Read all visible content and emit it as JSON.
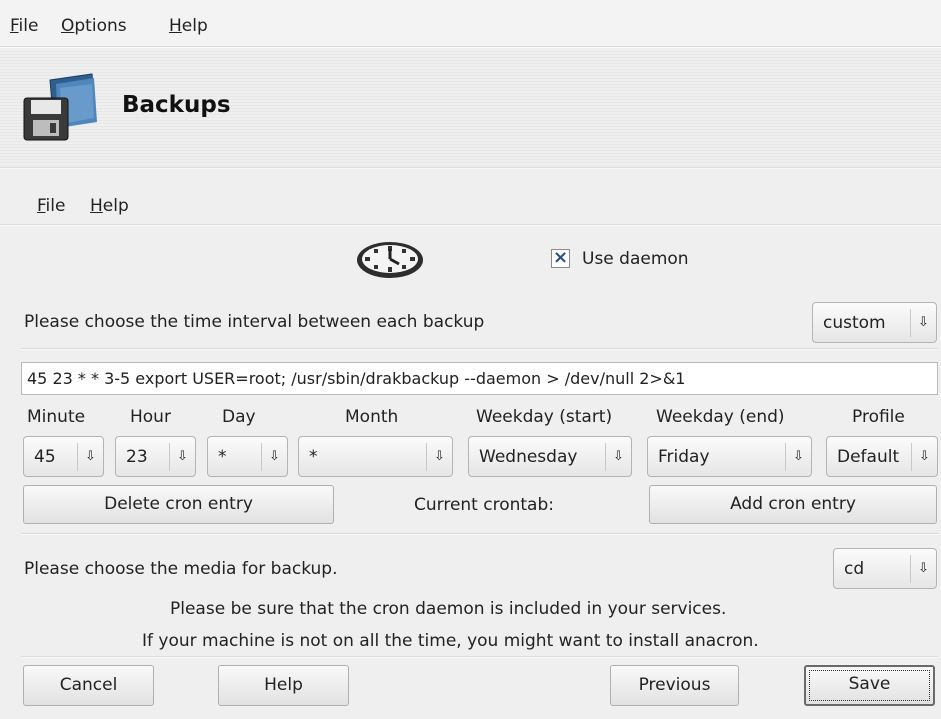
{
  "menubar": {
    "items": [
      {
        "label": "File",
        "mnemonic": "F",
        "rest": "ile"
      },
      {
        "label": "Options",
        "mnemonic": "O",
        "rest": "ptions"
      },
      {
        "label": "Help",
        "mnemonic": "H",
        "rest": "elp"
      }
    ]
  },
  "header": {
    "title": "Backups",
    "icon": "floppy-folder-icon"
  },
  "submenu": {
    "items": [
      {
        "label": "File",
        "mnemonic": "F",
        "rest": "ile"
      },
      {
        "label": "Help",
        "mnemonic": "H",
        "rest": "elp"
      }
    ]
  },
  "daemon": {
    "icon": "clock-icon",
    "checkbox_label": "Use daemon",
    "checked": true,
    "check_mark": "×"
  },
  "interval": {
    "prompt": "Please choose the time interval between each backup",
    "value": "custom"
  },
  "cron_line": "45 23 * * 3-5 export USER=root; /usr/sbin/drakbackup  --daemon > /dev/null 2>&1",
  "fields": {
    "minute": {
      "label": "Minute",
      "value": "45"
    },
    "hour": {
      "label": "Hour",
      "value": "23"
    },
    "day": {
      "label": "Day",
      "value": "*"
    },
    "month": {
      "label": "Month",
      "value": "*"
    },
    "weekday_start": {
      "label": "Weekday (start)",
      "value": "Wednesday"
    },
    "weekday_end": {
      "label": "Weekday (end)",
      "value": "Friday"
    },
    "profile": {
      "label": "Profile",
      "value": "Default"
    }
  },
  "cron_buttons": {
    "delete": "Delete cron entry",
    "current": "Current crontab:",
    "add": "Add cron entry"
  },
  "media": {
    "prompt": "Please choose the media for backup.",
    "value": "cd"
  },
  "notes": {
    "line1": "Please be sure that the cron daemon is included in your services.",
    "line2": "If your machine is not on all the time, you might want to install anacron."
  },
  "buttons": {
    "cancel": "Cancel",
    "help": "Help",
    "previous": "Previous",
    "save": "Save"
  },
  "arrow_glyph": "⇩"
}
